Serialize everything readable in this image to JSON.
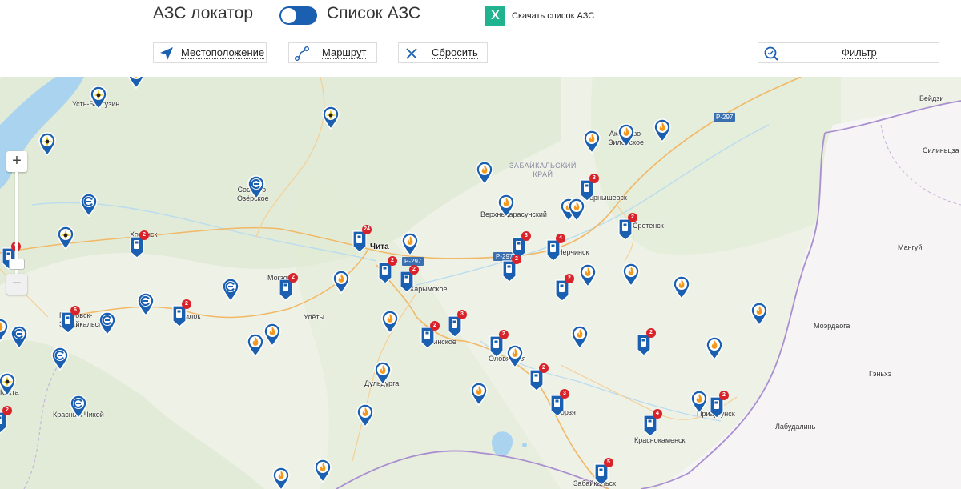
{
  "header": {
    "mode_left": "АЗС локатор",
    "mode_right": "Список АЗС",
    "excel_icon_letter": "X",
    "download_label": "Скачать список АЗС",
    "accent_color": "#1b5fb0",
    "excel_color": "#21b38f"
  },
  "toolbar": {
    "location_label": "Местоположение",
    "route_label": "Маршрут",
    "reset_label": "Сбросить",
    "filter_label": "Фильтр"
  },
  "map": {
    "zoom_in": "+",
    "zoom_out": "−",
    "region_label": "ЗАБАЙКАЛЬСКИЙ\nКРАЙ",
    "roads": {
      "r297_a": "Р-297",
      "r297_b": "Р-297",
      "r297_c": "Р-297"
    },
    "places": {
      "ust_barguzin": "Усть-Баргузин",
      "sosnovo_ozerskoe": "Сосново-\nОзёрское",
      "khorinsk": "Хоринск",
      "chita": "Чита",
      "mogzon": "Могзон",
      "petrovsk": "Петровск-\nЗабайкальский",
      "hilok": "Хилок",
      "ulety": "Улёты",
      "karymskoe": "Карымское",
      "aginskoe": "Агинское",
      "olovyannaya": "Оловянная",
      "duldurga": "Дульдурга",
      "krasny_chikoy": "Красный Чикой",
      "kyakhta": "Кяхта",
      "verkhnedarasunsky": "Верхнедарасунский",
      "chernyshevsk": "Чернышевск",
      "nerchinsk": "Нерчинск",
      "sretensk": "Сретенск",
      "aksenovo": "Аксёново-\nЗиловское",
      "beidzi": "Бейдзи",
      "silintsza": "Силиньцза",
      "mangui": "Мангуй",
      "moerdaoga": "Моэрдаога",
      "genhe": "Гэньхэ",
      "labudalin": "Лабудалинь",
      "borzya": "Борзя",
      "krasnokamensk": "Краснокаменск",
      "priargunsk": "Приаргунск",
      "zabaikalsk": "Забайкальск"
    },
    "marker_colors": {
      "blue": "#1b5fb0",
      "flame": "#f39a1e",
      "rosneft": "#f2c81e",
      "count": "#d8232a"
    },
    "markers": [
      {
        "type": "rosneft",
        "count": ""
      },
      {
        "type": "rosneft",
        "count": ""
      },
      {
        "type": "rosneft",
        "count": ""
      },
      {
        "type": "rosneft",
        "count": ""
      },
      {
        "type": "rosneft",
        "count": ""
      },
      {
        "type": "rosneft",
        "count": ""
      },
      {
        "type": "e",
        "count": ""
      },
      {
        "type": "e",
        "count": ""
      },
      {
        "type": "e",
        "count": ""
      },
      {
        "type": "e",
        "count": ""
      },
      {
        "type": "e",
        "count": ""
      },
      {
        "type": "e",
        "count": ""
      },
      {
        "type": "e",
        "count": ""
      },
      {
        "type": "e",
        "count": ""
      },
      {
        "type": "fuel",
        "count": "9"
      },
      {
        "type": "fuel",
        "count": "2"
      },
      {
        "type": "fuel",
        "count": "24"
      },
      {
        "type": "fuel",
        "count": "2"
      },
      {
        "type": "fuel",
        "count": "2"
      },
      {
        "type": "fuel",
        "count": "2"
      },
      {
        "type": "fuel",
        "count": "6"
      },
      {
        "type": "fuel",
        "count": "2"
      },
      {
        "type": "fuel",
        "count": "2"
      },
      {
        "type": "fuel",
        "count": "3"
      },
      {
        "type": "fuel",
        "count": "2"
      },
      {
        "type": "fuel",
        "count": "3"
      },
      {
        "type": "fuel",
        "count": "2"
      },
      {
        "type": "fuel",
        "count": "4"
      },
      {
        "type": "fuel",
        "count": "2"
      },
      {
        "type": "fuel",
        "count": "3"
      },
      {
        "type": "fuel",
        "count": "2"
      },
      {
        "type": "fuel",
        "count": "2"
      },
      {
        "type": "fuel",
        "count": "3"
      },
      {
        "type": "fuel",
        "count": "2"
      },
      {
        "type": "fuel",
        "count": "2"
      },
      {
        "type": "fuel",
        "count": "4"
      },
      {
        "type": "fuel",
        "count": "5"
      },
      {
        "type": "fuel",
        "count": "2"
      },
      {
        "type": "flame",
        "count": ""
      },
      {
        "type": "flame",
        "count": ""
      },
      {
        "type": "flame",
        "count": ""
      },
      {
        "type": "flame",
        "count": ""
      },
      {
        "type": "flame",
        "count": ""
      },
      {
        "type": "flame",
        "count": ""
      },
      {
        "type": "flame",
        "count": ""
      },
      {
        "type": "flame",
        "count": ""
      },
      {
        "type": "flame",
        "count": ""
      },
      {
        "type": "flame",
        "count": ""
      },
      {
        "type": "flame",
        "count": ""
      },
      {
        "type": "flame",
        "count": ""
      },
      {
        "type": "flame",
        "count": ""
      },
      {
        "type": "flame",
        "count": ""
      },
      {
        "type": "flame",
        "count": ""
      },
      {
        "type": "flame",
        "count": ""
      },
      {
        "type": "flame",
        "count": ""
      },
      {
        "type": "flame",
        "count": ""
      },
      {
        "type": "flame",
        "count": ""
      },
      {
        "type": "flame",
        "count": ""
      },
      {
        "type": "flame",
        "count": ""
      },
      {
        "type": "flame",
        "count": ""
      },
      {
        "type": "flame",
        "count": ""
      },
      {
        "type": "flame",
        "count": ""
      },
      {
        "type": "flame",
        "count": ""
      },
      {
        "type": "flame",
        "count": ""
      },
      {
        "type": "flame",
        "count": ""
      },
      {
        "type": "flame",
        "count": ""
      }
    ]
  }
}
